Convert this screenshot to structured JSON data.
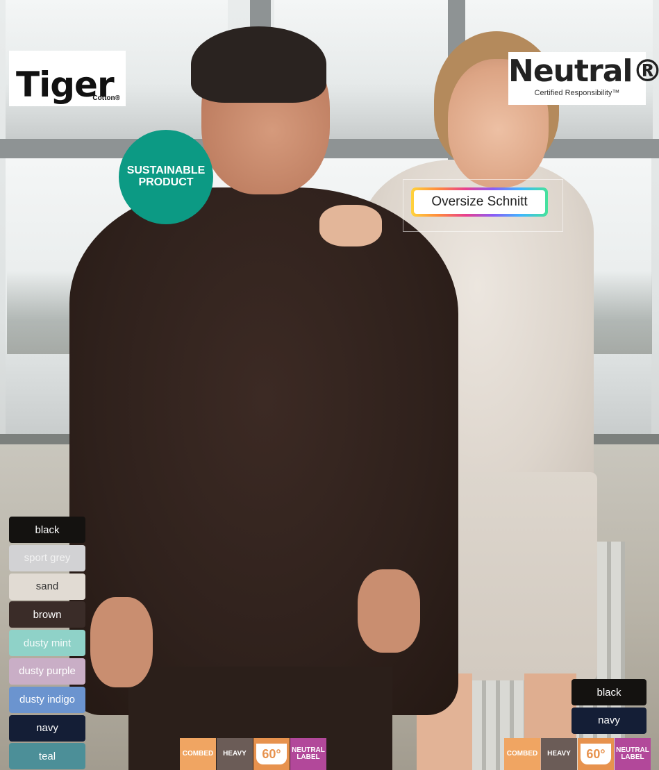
{
  "brand": {
    "tiger_word": "Tiger",
    "tiger_sub": "Cotton®",
    "neutral_word": "Neutral®",
    "neutral_sub": "Certified Responsibility™"
  },
  "badge": {
    "line1": "SUSTAINABLE",
    "line2": "PRODUCT",
    "color": "#0c9a84"
  },
  "fit_label": "Oversize Schnitt",
  "colors_left": [
    {
      "name": "black",
      "bg": "#141210",
      "fg": "#ffffff"
    },
    {
      "name": "sport grey",
      "bg": "#d2d2d4",
      "fg": "#f2f2f2"
    },
    {
      "name": "sand",
      "bg": "#e1dbd3",
      "fg": "#333333"
    },
    {
      "name": "brown",
      "bg": "#3a2c28",
      "fg": "#ffffff"
    },
    {
      "name": "dusty mint",
      "bg": "#8fd2c8",
      "fg": "#f4fbfa"
    },
    {
      "name": "dusty purple",
      "bg": "#c9aec6",
      "fg": "#ffffff"
    },
    {
      "name": "dusty indigo",
      "bg": "#6b94cf",
      "fg": "#ffffff"
    },
    {
      "name": "navy",
      "bg": "#141e36",
      "fg": "#ffffff"
    },
    {
      "name": "teal",
      "bg": "#4c8f98",
      "fg": "#ffffff"
    }
  ],
  "colors_right": [
    {
      "name": "black",
      "bg": "#141210",
      "fg": "#ffffff"
    },
    {
      "name": "navy",
      "bg": "#141e36",
      "fg": "#ffffff"
    }
  ],
  "features": {
    "combed": "COMBED",
    "heavy": "HEAVY",
    "wash": "60°",
    "label_line1": "NEUTRAL",
    "label_line2": "LABEL"
  }
}
